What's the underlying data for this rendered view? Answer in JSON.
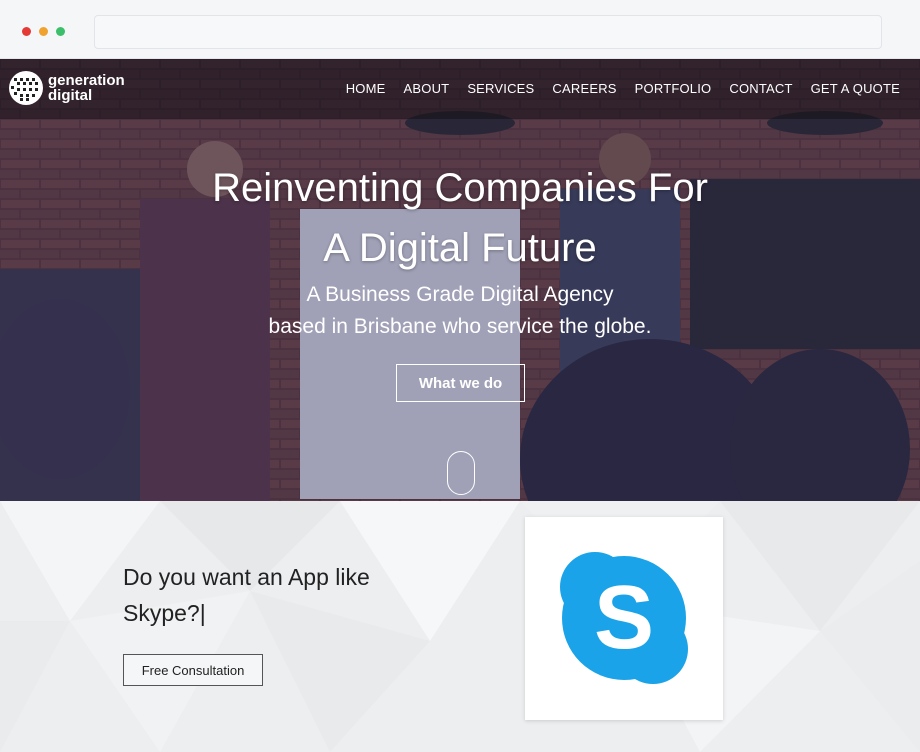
{
  "navbar": {
    "logo_line1": "generation",
    "logo_line2": "digital",
    "items": [
      "HOME",
      "ABOUT",
      "SERVICES",
      "CAREERS",
      "PORTFOLIO",
      "CONTACT",
      "GET A QUOTE"
    ]
  },
  "hero": {
    "title_line1": "Reinventing Companies For",
    "title_line2": "A Digital Future",
    "subtitle_line1": "A Business Grade Digital Agency",
    "subtitle_line2": "based in Brisbane who service the globe.",
    "cta_label": "What we do"
  },
  "promo": {
    "question_line1": "Do you want an App like",
    "question_line2": "Skype?|",
    "button_label": "Free Consultation",
    "logo_letter": "S",
    "logo_color": "#1aa3e8"
  },
  "colors": {
    "hero_overlay": "#2a2458",
    "chrome_red": "#e53935",
    "chrome_yellow": "#f0a22e",
    "chrome_green": "#3cbf6a"
  }
}
